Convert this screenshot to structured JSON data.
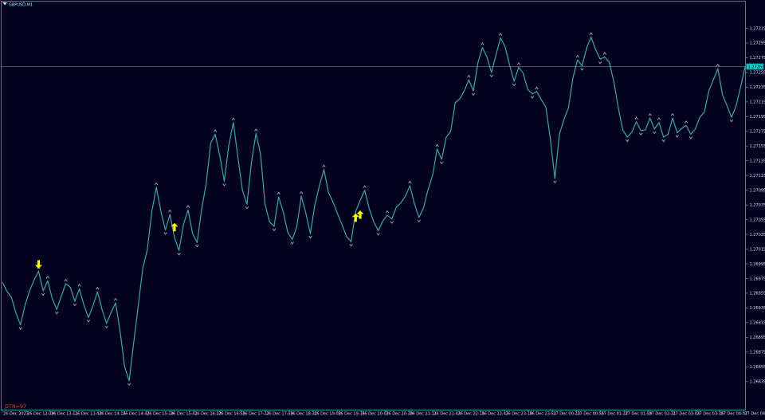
{
  "header": {
    "symbol_label": "GBPUSD,M1"
  },
  "indicator": {
    "label": "DTR=97"
  },
  "colors": {
    "background": "#02021f",
    "frame": "#2a8e8e",
    "price_line": "#3fa6a6",
    "fractal_marker": "#b8b8c8",
    "signal_arrow": "#ffff00",
    "current_price_bg": "#22c5c5",
    "indicator_text": "#e0401a",
    "axis_text": "#d8d8e8"
  },
  "chart_data": {
    "type": "line",
    "symbol": "GBPUSD",
    "timeframe": "M1",
    "current_price": 1.27263,
    "ylim": [
      1.26825,
      1.27335
    ],
    "y_ticks": [
      "1.27315",
      "1.27295",
      "1.27275",
      "1.27255",
      "1.27235",
      "1.27215",
      "1.27195",
      "1.27175",
      "1.27155",
      "1.27135",
      "1.27115",
      "1.27095",
      "1.27075",
      "1.27055",
      "1.27035",
      "1.27015",
      "1.26995",
      "1.26975",
      "1.26955",
      "1.26935",
      "1.26915",
      "1.26895",
      "1.26875",
      "1.26855",
      "1.26835"
    ],
    "x_ticks": [
      "26 Dec 2023",
      "26 Dec 12:39",
      "26 Dec 13:11",
      "26 Dec 13:43",
      "26 Dec 14:15",
      "26 Dec 14:47",
      "26 Dec 15:19",
      "26 Dec 15:51",
      "26 Dec 16:23",
      "26 Dec 16:55",
      "26 Dec 17:27",
      "26 Dec 17:59",
      "26 Dec 18:31",
      "26 Dec 19:03",
      "26 Dec 19:35",
      "26 Dec 20:07",
      "26 Dec 20:39",
      "26 Dec 21:11",
      "26 Dec 21:43",
      "26 Dec 22:15",
      "26 Dec 22:47",
      "26 Dec 23:19",
      "26 Dec 23:51",
      "27 Dec 00:23",
      "27 Dec 00:55",
      "27 Dec 01:27",
      "27 Dec 01:59",
      "27 Dec 02:31",
      "27 Dec 03:03",
      "27 Dec 03:35",
      "27 Dec 04:07",
      "27 Dec 04:39"
    ],
    "series": [
      {
        "values": [
          1.2697,
          1.26958,
          1.26949,
          1.26928,
          1.26912,
          1.26939,
          1.26958,
          1.26973,
          1.26985,
          1.26958,
          1.26972,
          1.26948,
          1.26933,
          1.26951,
          1.26968,
          1.26963,
          1.26944,
          1.26961,
          1.26939,
          1.26922,
          1.26938,
          1.26957,
          1.26933,
          1.26914,
          1.26929,
          1.26942,
          1.26903,
          1.26855,
          1.26836,
          1.26888,
          1.26938,
          1.26989,
          1.27014,
          1.27066,
          1.27099,
          1.27066,
          1.27041,
          1.27062,
          1.27031,
          1.27013,
          1.27049,
          1.27068,
          1.27036,
          1.27024,
          1.27069,
          1.27104,
          1.27159,
          1.27171,
          1.27142,
          1.27107,
          1.27156,
          1.27187,
          1.2714,
          1.27095,
          1.27076,
          1.27133,
          1.27172,
          1.27144,
          1.27076,
          1.27052,
          1.27046,
          1.27086,
          1.27066,
          1.27038,
          1.27028,
          1.27045,
          1.27087,
          1.27064,
          1.27036,
          1.27075,
          1.27101,
          1.27123,
          1.27092,
          1.27079,
          1.27063,
          1.27048,
          1.27032,
          1.27025,
          1.27066,
          1.27081,
          1.27095,
          1.2707,
          1.27052,
          1.2704,
          1.27053,
          1.27061,
          1.27056,
          1.27072,
          1.27078,
          1.27087,
          1.27101,
          1.27076,
          1.27058,
          1.27071,
          1.27096,
          1.27115,
          1.27151,
          1.27137,
          1.27167,
          1.27175,
          1.27214,
          1.27219,
          1.2723,
          1.27245,
          1.2723,
          1.27268,
          1.27289,
          1.27276,
          1.27255,
          1.27279,
          1.27302,
          1.2729,
          1.27265,
          1.27243,
          1.27262,
          1.27254,
          1.27232,
          1.27226,
          1.27229,
          1.27218,
          1.27208,
          1.27165,
          1.27111,
          1.27171,
          1.27191,
          1.27207,
          1.27248,
          1.27272,
          1.27264,
          1.27288,
          1.27303,
          1.27286,
          1.27273,
          1.27276,
          1.27269,
          1.27243,
          1.27207,
          1.27177,
          1.27167,
          1.27174,
          1.27188,
          1.27176,
          1.27177,
          1.27193,
          1.27178,
          1.27187,
          1.27167,
          1.27171,
          1.27193,
          1.27173,
          1.27179,
          1.27183,
          1.27171,
          1.27178,
          1.27194,
          1.27201,
          1.2723,
          1.27245,
          1.2726,
          1.27225,
          1.2721,
          1.27194,
          1.27209,
          1.27235,
          1.27263
        ]
      }
    ],
    "markers": [
      {
        "type": "arrow_down",
        "index": 8,
        "price": 1.26995
      },
      {
        "type": "arrow_up",
        "index": 38,
        "price": 1.27044
      },
      {
        "type": "arrow_up",
        "index": 78,
        "price": 1.27057
      },
      {
        "type": "arrow_up",
        "index": 79,
        "price": 1.27061
      }
    ],
    "grid": false
  }
}
